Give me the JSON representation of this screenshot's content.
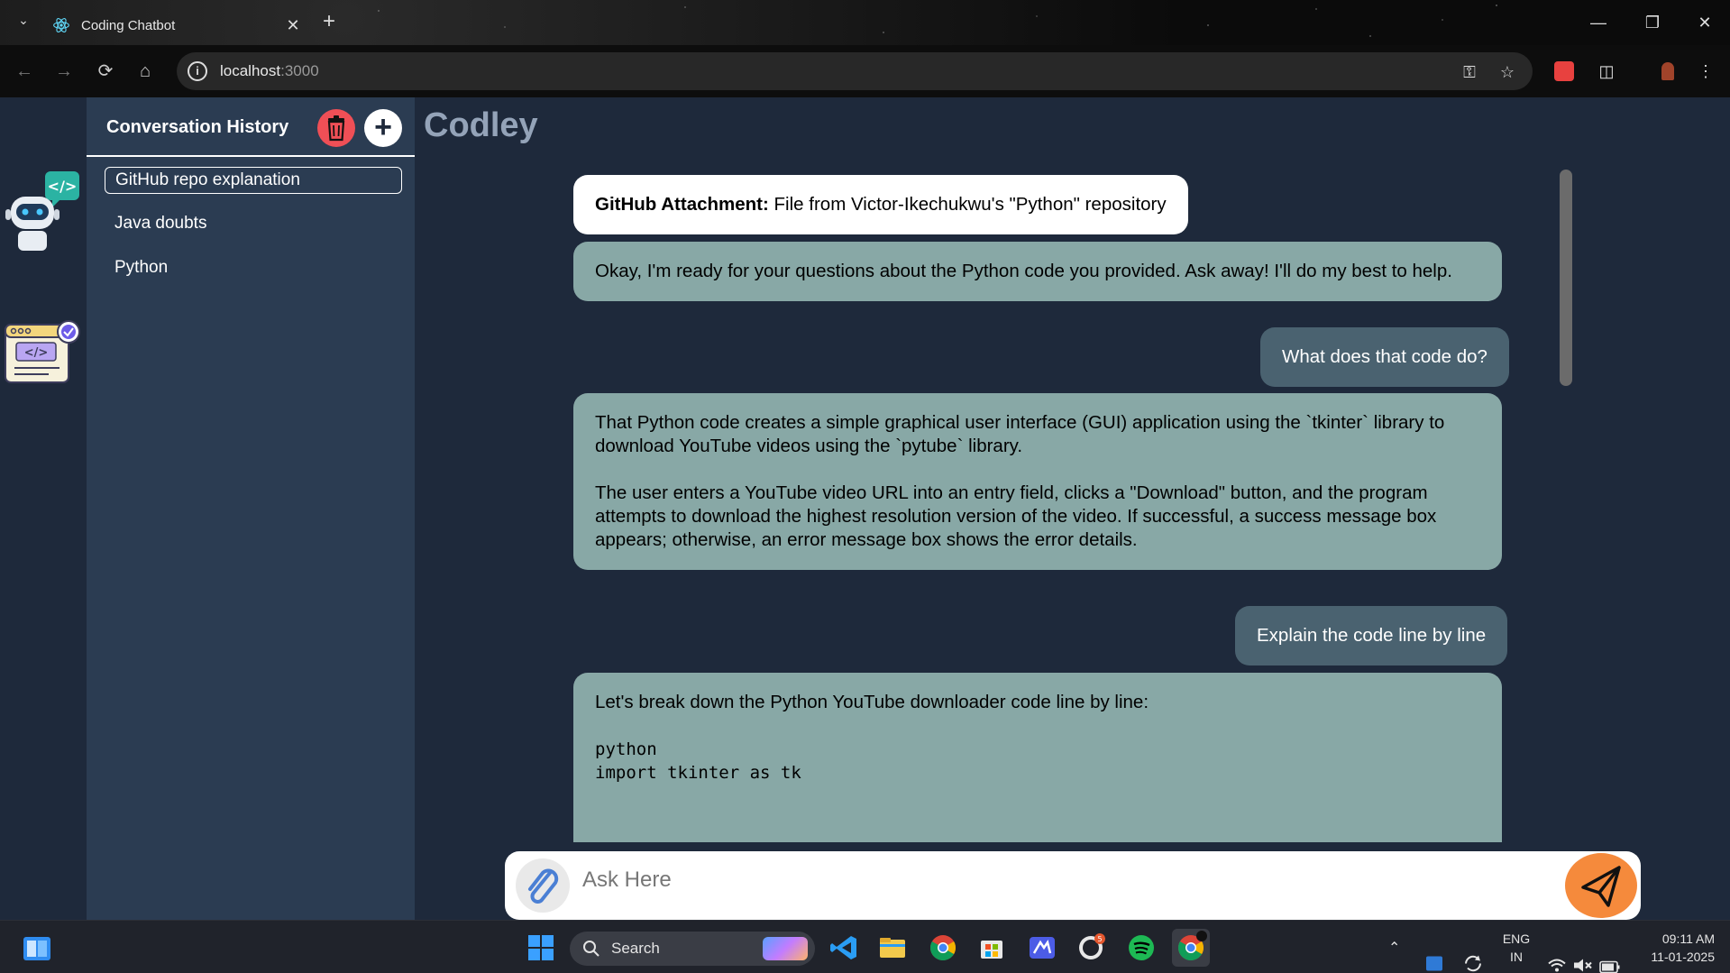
{
  "browser": {
    "tab_title": "Coding Chatbot",
    "url_host": "localhost",
    "url_port": ":3000"
  },
  "sidebar": {
    "title": "Conversation History",
    "items": [
      {
        "label": "GitHub repo explanation",
        "active": true
      },
      {
        "label": "Java doubts",
        "active": false
      },
      {
        "label": "Python",
        "active": false
      }
    ]
  },
  "chat": {
    "header": "Codley",
    "messages": [
      {
        "role": "attachment",
        "label": "GitHub Attachment:",
        "text": " File from Victor-Ikechukwu's \"Python\" repository"
      },
      {
        "role": "bot",
        "text": "Okay, I'm ready for your questions about the Python code you provided.  Ask away! I'll do my best to help."
      },
      {
        "role": "user",
        "text": "What does that code do?"
      },
      {
        "role": "bot",
        "p1": "That Python code creates a simple graphical user interface (GUI) application using the `tkinter` library to download YouTube videos using the `pytube` library.",
        "p2": "The user enters a YouTube video URL into an entry field, clicks a \"Download\" button, and the program attempts to download the highest resolution version of the video.  If successful, a success message box appears; otherwise, an error message box shows the error details."
      },
      {
        "role": "user",
        "text": "Explain the code line by line"
      },
      {
        "role": "bot",
        "intro": "Let's break down the Python YouTube downloader code line by line:",
        "code1": "python",
        "code2": "import tkinter as tk"
      }
    ]
  },
  "composer": {
    "placeholder": "Ask Here"
  },
  "taskbar": {
    "search_label": "Search",
    "lang_1": "ENG",
    "lang_2": "IN",
    "time": "09:11 AM",
    "date": "11-01-2025",
    "badge_count": "5"
  },
  "colors": {
    "app_bg": "#1e293b",
    "sidebar_bg": "#2b3c52",
    "bot_bubble": "#88a8a6",
    "user_bubble": "#4a6270",
    "trash": "#ef4f56",
    "send": "#f58a3c"
  }
}
